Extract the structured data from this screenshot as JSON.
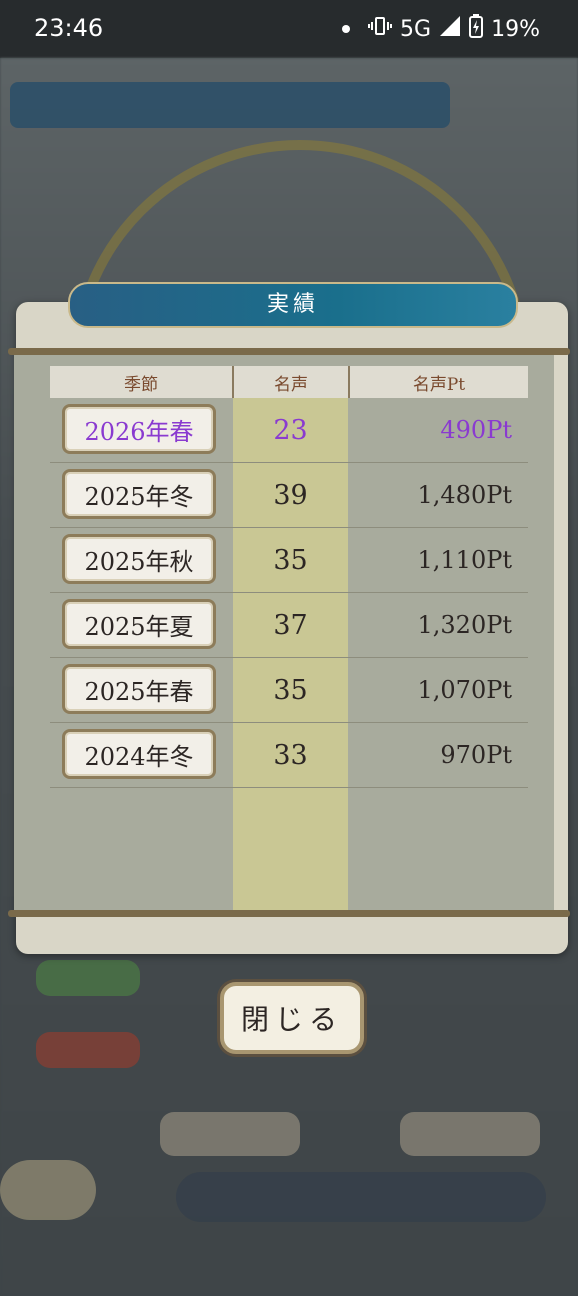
{
  "status_bar": {
    "time": "23:46",
    "network": "5G",
    "battery": "19%"
  },
  "dialog": {
    "title": "実績",
    "headers": {
      "season": "季節",
      "fame": "名声",
      "fame_pt": "名声Pt"
    },
    "rows": [
      {
        "season": "2026年春",
        "fame": "23",
        "fame_pt": "490Pt",
        "current": true
      },
      {
        "season": "2025年冬",
        "fame": "39",
        "fame_pt": "1,480Pt"
      },
      {
        "season": "2025年秋",
        "fame": "35",
        "fame_pt": "1,110Pt"
      },
      {
        "season": "2025年夏",
        "fame": "37",
        "fame_pt": "1,320Pt"
      },
      {
        "season": "2025年春",
        "fame": "35",
        "fame_pt": "1,070Pt"
      },
      {
        "season": "2024年冬",
        "fame": "33",
        "fame_pt": "970Pt"
      }
    ],
    "close_label": "閉じる"
  },
  "colors": {
    "current_highlight": "#8a3ad0",
    "title_bar": "#1a6f8c",
    "fame_column": "#c9c794"
  }
}
